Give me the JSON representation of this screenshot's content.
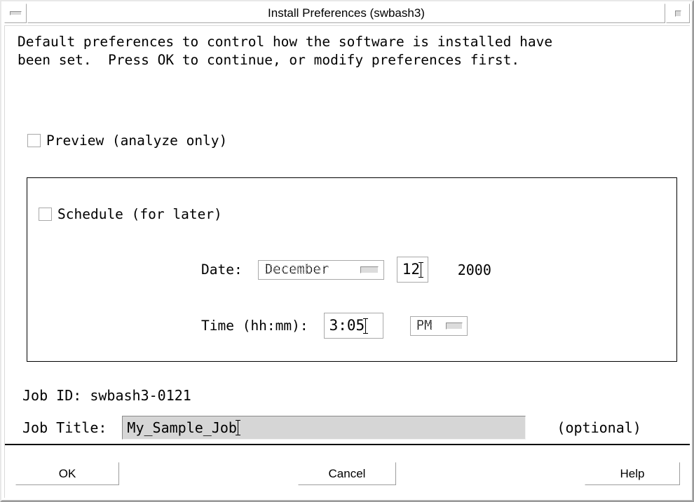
{
  "window": {
    "title": "Install Preferences (swbash3)",
    "minimize_icon": "minimize-icon",
    "maximize_icon": "maximize-icon"
  },
  "description": {
    "line1": "Default preferences to control how the software is installed have",
    "line2": "been set.  Press OK to continue, or modify preferences first."
  },
  "preview": {
    "label": "Preview (analyze only)",
    "checked": false
  },
  "schedule": {
    "label": "Schedule (for later)",
    "checked": false,
    "date": {
      "label": "Date:",
      "month": "December",
      "day": "12",
      "year": "2000"
    },
    "time": {
      "label": "Time (hh:mm):",
      "value": "3:05",
      "ampm": "PM"
    }
  },
  "job": {
    "id_text": "Job ID: swbash3-0121",
    "title_label": "Job Title:",
    "title_value": "My_Sample_Job",
    "title_placeholder": "",
    "optional_text": "(optional)"
  },
  "buttons": {
    "ok": "OK",
    "cancel": "Cancel",
    "help": "Help"
  },
  "colors": {
    "window_bg": "#ffffff",
    "frame_shadow": "#9a9a9a",
    "frame_light": "#e8e8e8",
    "field_border": "#a9a9a9",
    "input_bg": "#d6d6d6",
    "group_border": "#000000",
    "text": "#000000"
  }
}
